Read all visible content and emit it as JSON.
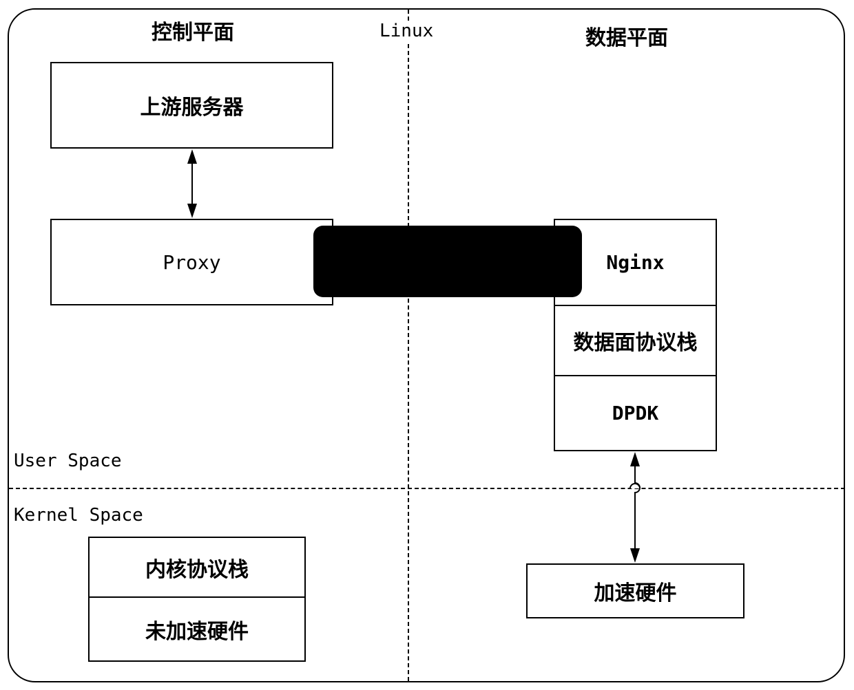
{
  "diagram": {
    "sections": {
      "control_plane": "控制平面",
      "os": "Linux",
      "data_plane": "数据平面",
      "user_space": "User Space",
      "kernel_space": "Kernel Space"
    },
    "control_plane_boxes": {
      "upstream_server": "上游服务器",
      "proxy": "Proxy"
    },
    "connector_box": {
      "label": "",
      "fill_color": "#000000"
    },
    "data_plane_stack": {
      "nginx": "Nginx",
      "protocol_stack": "数据面协议栈",
      "dpdk": "DPDK"
    },
    "kernel_stack": {
      "kernel_protocol_stack": "内核协议栈",
      "non_accelerated_hardware": "未加速硬件"
    },
    "accelerated_hardware": "加速硬件",
    "connections": [
      {
        "from": "upstream_server",
        "to": "proxy",
        "type": "bidirectional"
      },
      {
        "from": "dpdk",
        "to": "accelerated_hardware",
        "type": "bidirectional"
      }
    ]
  }
}
